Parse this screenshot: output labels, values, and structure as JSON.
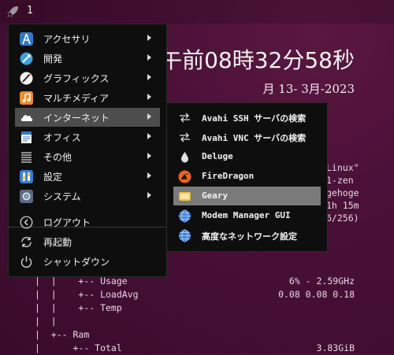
{
  "topbar": {
    "workspace": "1"
  },
  "clock": {
    "time": "午前08時32分58秒",
    "date": "月 13- 3月-2023"
  },
  "conky_right": [
    "Linux\"",
    "1-zen",
    "gehoge",
    "1h 15m",
    "6/256)"
  ],
  "conky_tree": [
    "  +-- Usage",
    "  +-- LoadAvg",
    "  +-- Temp",
    "",
    "+-- Ram",
    "  +-- Total"
  ],
  "conky_values": [
    "6% - 2.59GHz",
    "0.08 0.08 0.18",
    "",
    "",
    "",
    "3.83GiB"
  ],
  "menu": {
    "items": [
      {
        "label": "アクセサリ",
        "icon": "accessories-icon"
      },
      {
        "label": "開発",
        "icon": "development-icon"
      },
      {
        "label": "グラフィックス",
        "icon": "graphics-icon"
      },
      {
        "label": "マルチメディア",
        "icon": "multimedia-icon"
      },
      {
        "label": "インターネット",
        "icon": "internet-icon"
      },
      {
        "label": "オフィス",
        "icon": "office-icon"
      },
      {
        "label": "その他",
        "icon": "other-icon"
      },
      {
        "label": "設定",
        "icon": "settings-icon"
      },
      {
        "label": "システム",
        "icon": "system-icon"
      }
    ],
    "actions": [
      {
        "label": "ログアウト",
        "icon": "logout-icon"
      },
      {
        "label": "再起動",
        "icon": "reboot-icon"
      },
      {
        "label": "シャットダウン",
        "icon": "shutdown-icon"
      }
    ]
  },
  "submenu": {
    "items": [
      {
        "label": "Avahi SSH サーバの検索"
      },
      {
        "label": "Avahi VNC サーバの検索"
      },
      {
        "label": "Deluge"
      },
      {
        "label": "FireDragon"
      },
      {
        "label": "Geary"
      },
      {
        "label": "Modem Manager GUI"
      },
      {
        "label": "高度なネットワーク設定"
      }
    ]
  }
}
